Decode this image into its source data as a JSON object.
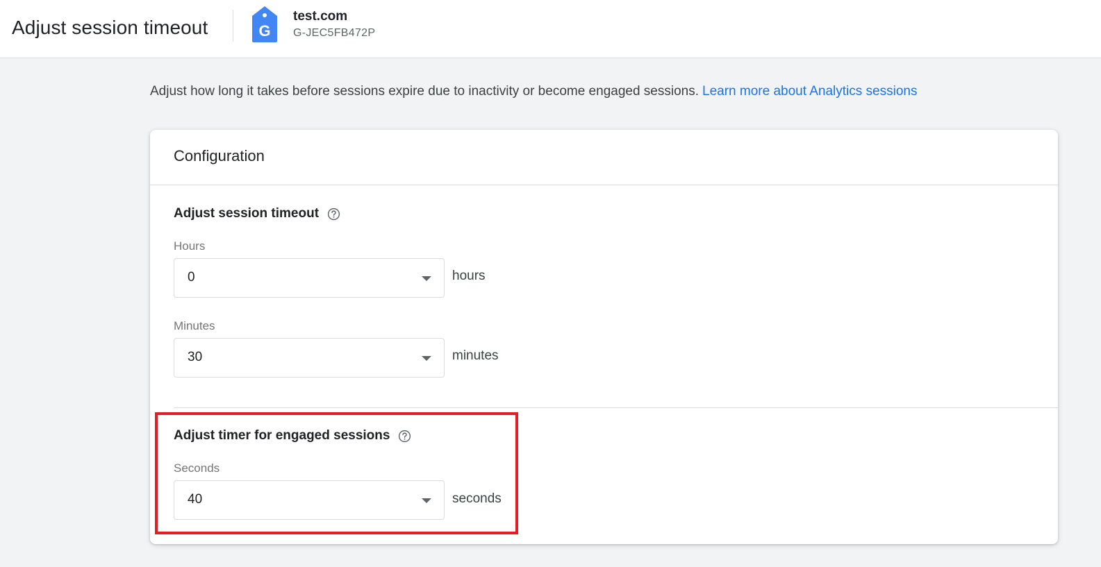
{
  "header": {
    "page_title": "Adjust session timeout",
    "property_name": "test.com",
    "property_id": "G-JEC5FB472P",
    "tag_icon": "google-tag-icon",
    "tag_letter": "G"
  },
  "description": {
    "text": "Adjust how long it takes before sessions expire due to inactivity or become engaged sessions.",
    "link_text": "Learn more about Analytics sessions"
  },
  "card": {
    "title": "Configuration",
    "session_timeout": {
      "title": "Adjust session timeout",
      "help_icon": "help-circle-icon",
      "hours": {
        "label": "Hours",
        "value": "0",
        "unit": "hours"
      },
      "minutes": {
        "label": "Minutes",
        "value": "30",
        "unit": "minutes"
      }
    },
    "engaged_sessions": {
      "title": "Adjust timer for engaged sessions",
      "help_icon": "help-circle-icon",
      "seconds": {
        "label": "Seconds",
        "value": "40",
        "unit": "seconds"
      }
    }
  },
  "colors": {
    "accent": "#1a73e8",
    "tag_blue": "#4285f4",
    "highlight": "#e21d24",
    "background": "#f1f3f4"
  }
}
